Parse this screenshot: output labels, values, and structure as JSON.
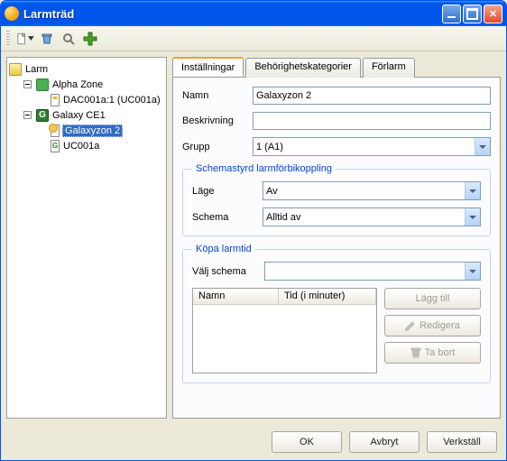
{
  "window": {
    "title": "Larmträd"
  },
  "toolbar": {
    "new": "new-icon",
    "delete": "trashcan-icon",
    "search": "magnifier-icon",
    "add": "plus-icon"
  },
  "tree": {
    "root": "Larm",
    "items": [
      {
        "label": "Alpha Zone",
        "children": [
          {
            "label": "DAC001a:1 (UC001a)"
          }
        ]
      },
      {
        "label": "Galaxy CE1",
        "children": [
          {
            "label": "Galaxyzon 2",
            "selected": true
          },
          {
            "label": "UC001a"
          }
        ]
      }
    ]
  },
  "tabs": {
    "settings": "Inställningar",
    "permissions": "Behörighetskategorier",
    "prealarm": "Förlarm"
  },
  "form": {
    "name_label": "Namn",
    "name_value": "Galaxyzon 2",
    "desc_label": "Beskrivning",
    "desc_value": "",
    "group_label": "Grupp",
    "group_value": "1 (A1)"
  },
  "schedule": {
    "legend": "Schemastyrd larmförbikoppling",
    "mode_label": "Läge",
    "mode_value": "Av",
    "schema_label": "Schema",
    "schema_value": "Alltid av"
  },
  "purchase": {
    "legend": "Köpa larmtid",
    "select_label": "Välj schema",
    "select_value": "",
    "col_name": "Namn",
    "col_time": "Tid (i minuter)",
    "add": "Lägg till",
    "edit": "Redigera",
    "remove": "Ta bort"
  },
  "footer": {
    "ok": "OK",
    "cancel": "Avbryt",
    "apply": "Verkställ"
  }
}
